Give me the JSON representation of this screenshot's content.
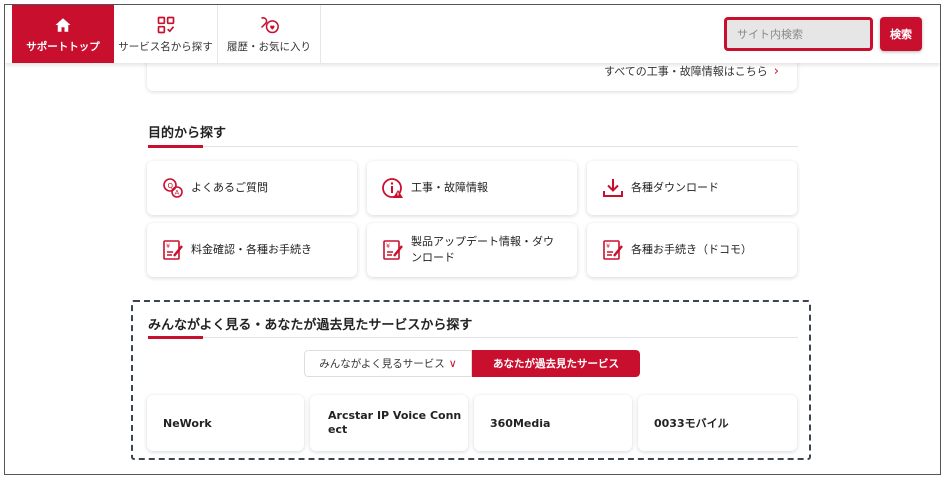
{
  "header": {
    "nav": [
      {
        "label": "サポートトップ",
        "icon": "home-icon"
      },
      {
        "label": "サービス名から探す",
        "icon": "checklist-grid-icon"
      },
      {
        "label": "履歴・お気に入り",
        "icon": "bookmark-heart-icon"
      }
    ],
    "search": {
      "placeholder": "サイト内検索",
      "button_label": "検索"
    }
  },
  "prev_section": {
    "link_label": "すべての工事・故障情報はこちら"
  },
  "purpose_section": {
    "title": "目的から探す",
    "cards": [
      {
        "label": "よくあるご質問",
        "icon": "faq-icon"
      },
      {
        "label": "工事・故障情報",
        "icon": "info-alert-icon"
      },
      {
        "label": "各種ダウンロード",
        "icon": "download-icon"
      },
      {
        "label": "料金確認・各種お手続き",
        "icon": "yen-form-icon"
      },
      {
        "label": "製品アップデート情報・ダウンロード",
        "icon": "yen-form-icon"
      },
      {
        "label": "各種お手続き（ドコモ）",
        "icon": "yen-form-icon"
      }
    ]
  },
  "services_section": {
    "title": "みんながよく見る・あなたが過去見たサービスから探す",
    "tabs": [
      {
        "label": "みんながよく見るサービス",
        "active": false
      },
      {
        "label": "あなたが過去見たサービス",
        "active": true
      }
    ],
    "items": [
      "NeWork",
      "Arcstar IP Voice Connect",
      "360Media",
      "0033モバイル"
    ]
  },
  "colors": {
    "accent": "#c8102e",
    "dashed_border": "#3c4552"
  }
}
